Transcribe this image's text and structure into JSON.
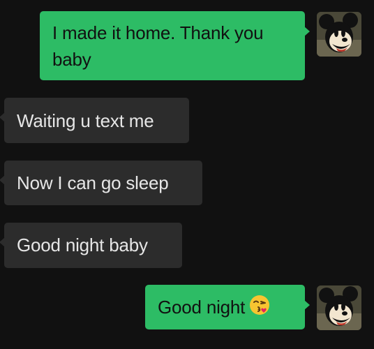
{
  "messages": [
    {
      "side": "out",
      "text_line1": "I made it home. Thank you",
      "text_line2": "baby",
      "avatar": "mickey-avatar"
    },
    {
      "side": "in",
      "text": "Waiting u text me"
    },
    {
      "side": "in",
      "text": "Now I can go sleep"
    },
    {
      "side": "in",
      "text": "Good night baby"
    },
    {
      "side": "out",
      "text": "Good night",
      "emoji": "😘",
      "emoji_icon": "kiss-face-emoji-icon",
      "avatar": "mickey-avatar"
    }
  ],
  "colors": {
    "background": "#111111",
    "outgoing_bubble": "#2dbc65",
    "incoming_bubble": "#2c2c2c",
    "incoming_text": "#e6e6e6"
  }
}
